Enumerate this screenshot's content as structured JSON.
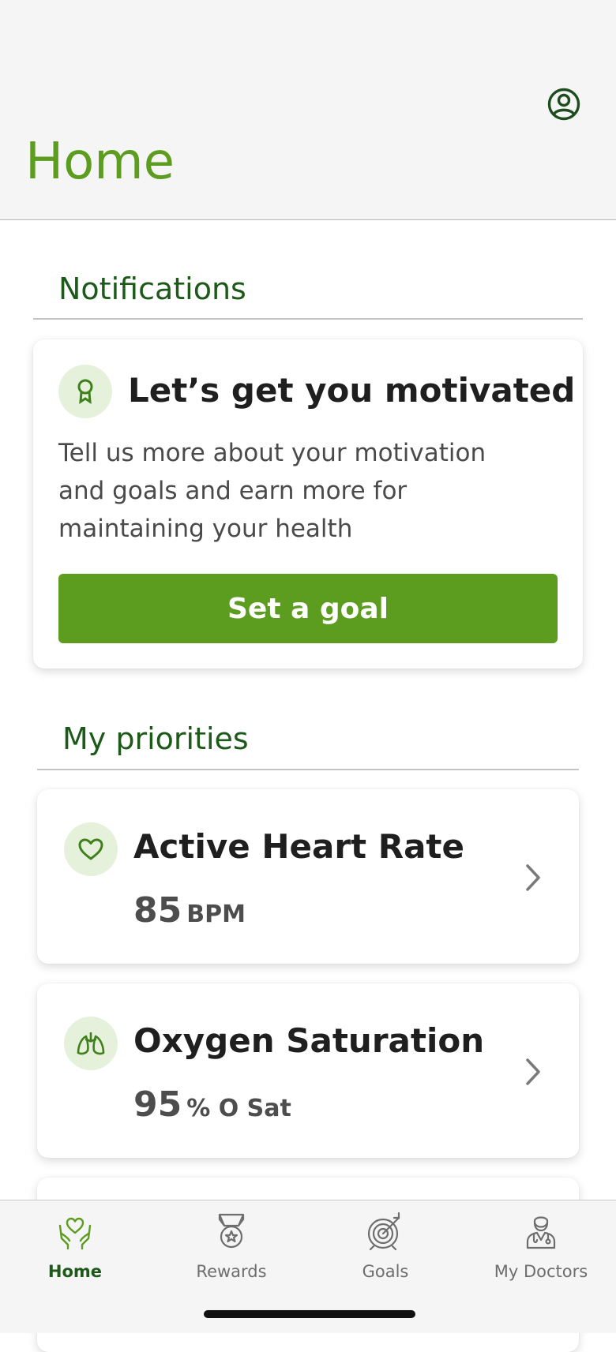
{
  "header": {
    "title": "Home"
  },
  "notifications": {
    "section_title": "Notifications",
    "card": {
      "title": "Let’s get you motivated",
      "body": "Tell us more about your motivation and goals and earn more for maintaining your health",
      "cta_label": "Set a goal"
    }
  },
  "priorities": {
    "section_title": "My priorities",
    "items": [
      {
        "title": "Active Heart Rate",
        "value": "85",
        "unit": "BPM",
        "icon": "heart-icon"
      },
      {
        "title": "Oxygen Saturation",
        "value": "95",
        "unit": "% O Sat",
        "icon": "lungs-icon"
      }
    ]
  },
  "tabbar": {
    "tabs": [
      {
        "label": "Home",
        "icon": "heart-in-hands-icon",
        "active": true
      },
      {
        "label": "Rewards",
        "icon": "medal-icon",
        "active": false
      },
      {
        "label": "Goals",
        "icon": "target-icon",
        "active": false
      },
      {
        "label": "My Doctors",
        "icon": "doctor-icon",
        "active": false
      }
    ]
  },
  "colors": {
    "brand_green": "#5c9c1e",
    "dark_green": "#1d5a1a",
    "icon_circle_bg": "#e6f1dc",
    "header_bg": "#f5f5f5"
  }
}
